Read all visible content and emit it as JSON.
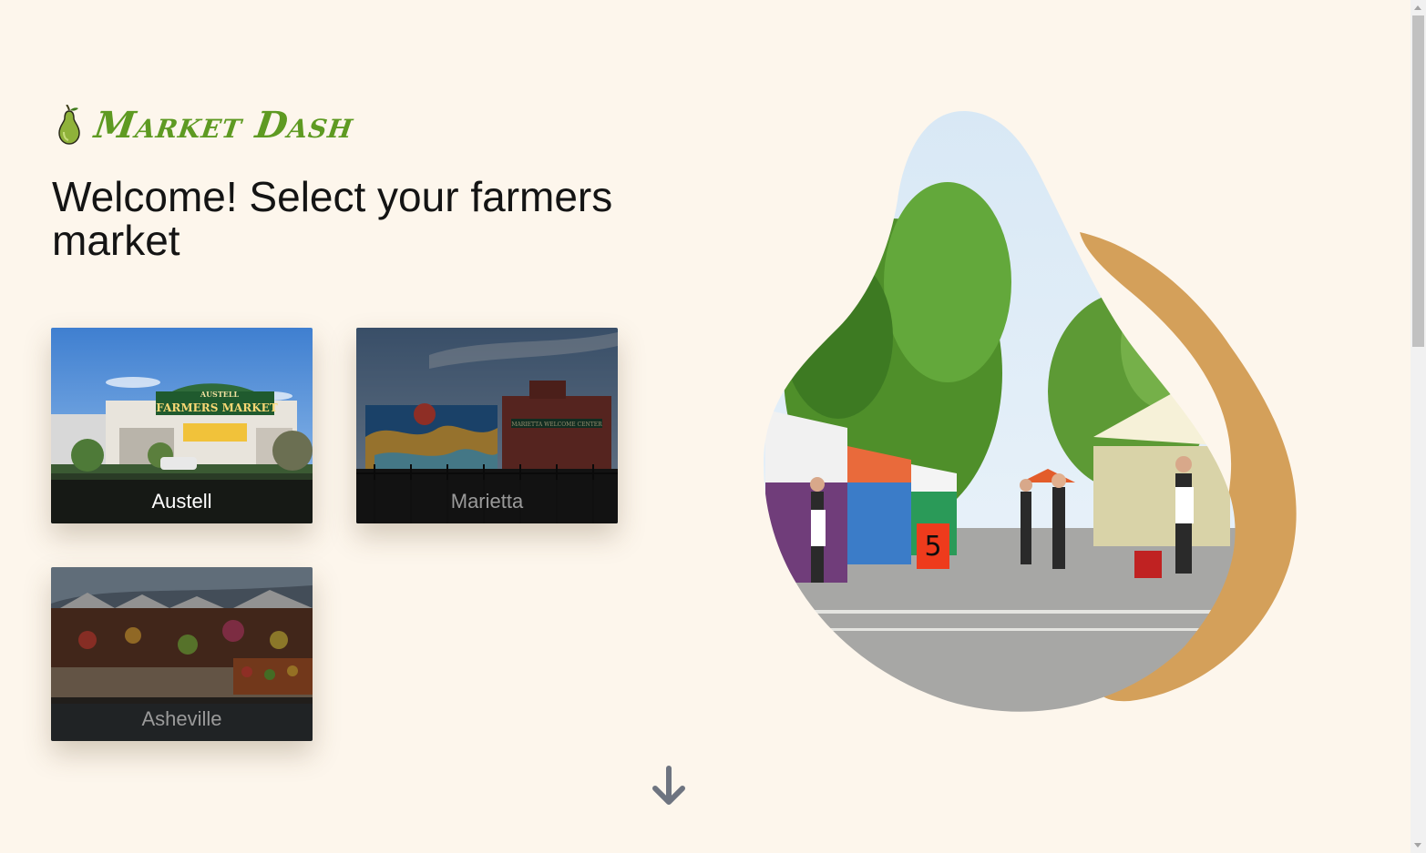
{
  "brand": {
    "name": "Market Dash",
    "logo_icon": "pear-icon",
    "color": "#5e9a22"
  },
  "headline": "Welcome! Select your farmers market",
  "markets": [
    {
      "label": "Austell",
      "selected": true,
      "photo_sign_top": "AUSTELL",
      "photo_sign_main": "FARMERS MARKET"
    },
    {
      "label": "Marietta",
      "selected": false,
      "photo_sign_main": "MARIETTA WELCOME CENTER"
    },
    {
      "label": "Asheville",
      "selected": false
    }
  ],
  "hero": {
    "stall_number": "5",
    "accent_color": "#d4a05a"
  },
  "scroll_icon": "arrow-down-icon"
}
